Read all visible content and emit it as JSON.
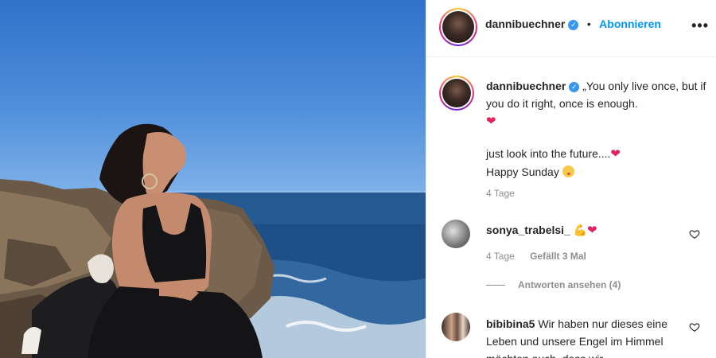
{
  "post_header": {
    "username": "dannibuechner",
    "separator": "•",
    "follow_label": "Abonnieren",
    "more_label": "•••"
  },
  "caption": {
    "username": "dannibuechner",
    "line1": "„You only live once, but if you do it right, once is enough.",
    "line2": "just look into the future....",
    "line3": "Happy Sunday",
    "age": "4 Tage"
  },
  "comments": [
    {
      "username": "sonya_trabelsi_",
      "age": "4 Tage",
      "likes": "Gefällt 3 Mal",
      "replies": "Antworten ansehen (4)"
    },
    {
      "username": "bibibina5",
      "text": "Wir haben nur dieses eine Leben und unsere Engel im Himmel möchten auch, dass wir"
    }
  ],
  "colors": {
    "link_blue": "#0095f6",
    "verified_blue": "#3897f0",
    "heart_red": "#e0245e",
    "muted": "#8e8e8e"
  },
  "icons": [
    "verified-badge-icon",
    "more-options-icon",
    "heart-emoji-icon",
    "flexed-biceps-emoji-icon",
    "kiss-face-emoji-icon",
    "like-heart-icon"
  ]
}
